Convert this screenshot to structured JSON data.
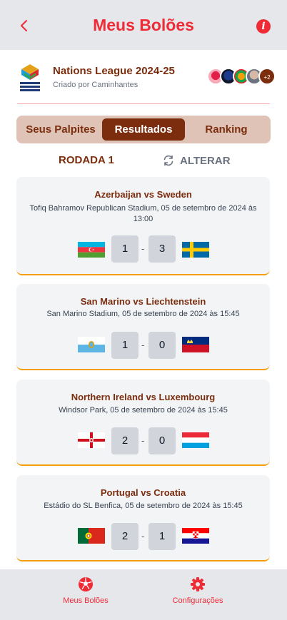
{
  "header": {
    "title": "Meus Bolões",
    "back_icon": "chevron-left-icon",
    "info_icon": "info-icon",
    "accent_color": "#ef2b36"
  },
  "league": {
    "name": "Nations League 2024-25",
    "creator": "Criado por Caminhantes",
    "logo_text": "UEFA NATIONS LEAGUE",
    "extra_members": "+2"
  },
  "tabs": [
    {
      "label": "Seus Palpites",
      "active": false
    },
    {
      "label": "Resultados",
      "active": true
    },
    {
      "label": "Ranking",
      "active": false
    }
  ],
  "round": {
    "label": "RODADA 1",
    "change_label": "ALTERAR"
  },
  "matches": [
    {
      "title": "Azerbaijan vs Sweden",
      "venue": "Tofiq Bahramov Republican Stadium, 05 de setembro de 2024 às 13:00",
      "home_score": "1",
      "away_score": "3",
      "home_flag": "azerbaijan-flag",
      "away_flag": "sweden-flag"
    },
    {
      "title": "San Marino vs Liechtenstein",
      "venue": "San Marino Stadium, 05 de setembro de 2024 às 15:45",
      "home_score": "1",
      "away_score": "0",
      "home_flag": "san-marino-flag",
      "away_flag": "liechtenstein-flag"
    },
    {
      "title": "Northern Ireland vs Luxembourg",
      "venue": "Windsor Park, 05 de setembro de 2024 às 15:45",
      "home_score": "2",
      "away_score": "0",
      "home_flag": "northern-ireland-flag",
      "away_flag": "luxembourg-flag"
    },
    {
      "title": "Portugal vs Croatia",
      "venue": "Estádio do SL Benfica, 05 de setembro de 2024 às 15:45",
      "home_score": "2",
      "away_score": "1",
      "home_flag": "portugal-flag",
      "away_flag": "croatia-flag"
    }
  ],
  "nav": {
    "items": [
      {
        "label": "Meus Bolões",
        "icon": "soccer-ball-icon"
      },
      {
        "label": "Configurações",
        "icon": "gear-icon"
      }
    ]
  }
}
